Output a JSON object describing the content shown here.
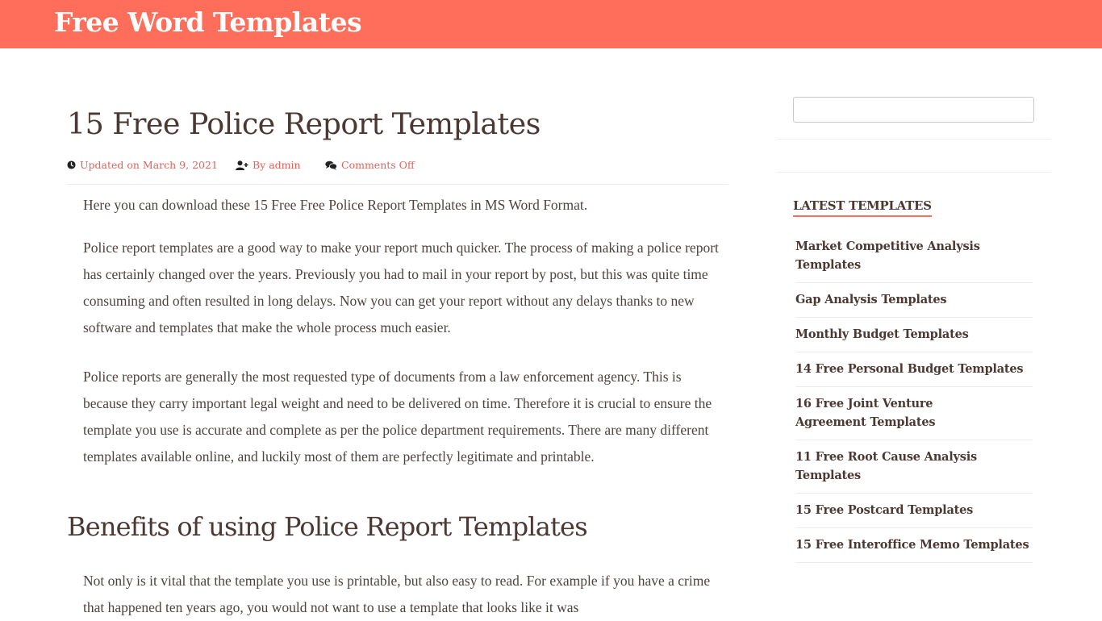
{
  "site": {
    "title": "Free Word Templates",
    "brand_color": "#ff6e5a",
    "accent_link_color": "#e0625a"
  },
  "article": {
    "title": "15 Free Police Report Templates",
    "meta": {
      "updated_icon": "clock-icon",
      "updated_label": "Updated on March 9, 2021",
      "author_icon": "user-plus-icon",
      "author_label": "By admin",
      "comments_icon": "comments-icon",
      "comments_label": "Comments Off"
    },
    "paragraphs": [
      "Here you can download these 15 Free Free Police Report Templates in MS Word Format.",
      "Police report templates are a good way to make your report much quicker. The process of making a police report has certainly changed over the years. Previously you had to mail in your report by post, but this was quite time consuming and often resulted in long delays. Now you can get your report without any delays thanks to new software and templates that make the whole process much easier.",
      "Police reports are generally the most requested type of documents from a law enforcement agency. This is because they carry important legal weight and need to be delivered on time. Therefore it is crucial to ensure the template you use is accurate and complete as per the police department requirements. There are many different templates available online, and luckily most of them are perfectly legitimate and printable."
    ],
    "section_heading": "Benefits of using Police Report Templates",
    "section_paragraph": "Not only is it vital that the template you use is printable, but also easy to read. For example if you have a crime that happened ten years ago, you would not want to use a template that looks like it was"
  },
  "sidebar": {
    "search": {
      "value": "",
      "placeholder": ""
    },
    "latest": {
      "title": "LATEST TEMPLATES",
      "items": [
        {
          "label": "Market Competitive Analysis Templates"
        },
        {
          "label": "Gap Analysis Templates"
        },
        {
          "label": "Monthly Budget Templates"
        },
        {
          "label": "14 Free Personal Budget Templates"
        },
        {
          "label": "16 Free Joint Venture Agreement Templates"
        },
        {
          "label": "11 Free Root Cause Analysis Templates"
        },
        {
          "label": "15 Free Postcard Templates"
        },
        {
          "label": "15 Free Interoffice Memo Templates"
        }
      ]
    }
  }
}
